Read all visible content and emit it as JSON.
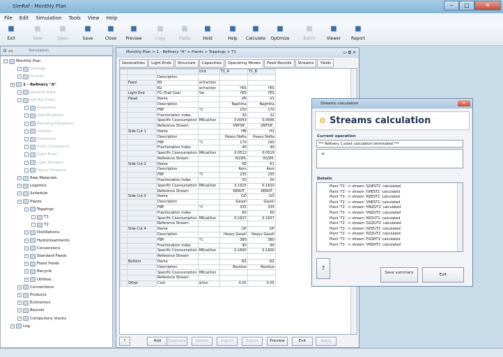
{
  "app": {
    "title": "SimRaf - Monthly Plan"
  },
  "menu": [
    "File",
    "Edit",
    "Simulation",
    "Tools",
    "View",
    "Help"
  ],
  "toolbar": [
    {
      "label": "Exit",
      "icon": "exit-icon",
      "enabled": true
    },
    {
      "label": "New",
      "icon": "new-icon",
      "enabled": false
    },
    {
      "label": "Open",
      "icon": "open-icon",
      "enabled": false
    },
    {
      "label": "Save",
      "icon": "save-icon",
      "enabled": true
    },
    {
      "label": "Close",
      "icon": "close-folder-icon",
      "enabled": true
    },
    {
      "label": "Preview",
      "icon": "preview-icon",
      "enabled": true
    },
    {
      "label": "Copy",
      "icon": "copy-icon",
      "enabled": false
    },
    {
      "label": "Paste",
      "icon": "paste-icon",
      "enabled": false
    },
    {
      "label": "Hold",
      "icon": "hold-icon",
      "enabled": true
    },
    {
      "label": "Help",
      "icon": "help-icon",
      "enabled": true
    },
    {
      "label": "Calculate",
      "icon": "calculate-icon",
      "enabled": true
    },
    {
      "label": "Optimize",
      "icon": "optimize-icon",
      "enabled": true
    },
    {
      "label": "Batch",
      "icon": "batch-icon",
      "enabled": false
    },
    {
      "label": "Viewer",
      "icon": "viewer-icon",
      "enabled": true
    },
    {
      "label": "Report",
      "icon": "report-icon",
      "enabled": true
    }
  ],
  "left_panel": {
    "tab_label": "Simulation"
  },
  "tree": [
    {
      "label": "Monthly Plan",
      "indent": 0,
      "dim": false,
      "bold": false
    },
    {
      "label": "Settings",
      "indent": 2,
      "dim": true,
      "bold": false
    },
    {
      "label": "Periods",
      "indent": 2,
      "dim": true,
      "bold": false
    },
    {
      "label": "1 - Refinery \"A\"",
      "indent": 1,
      "dim": false,
      "bold": true
    },
    {
      "label": "General Data",
      "indent": 2,
      "dim": true,
      "bold": false
    },
    {
      "label": "Sell Est Data",
      "indent": 2,
      "dim": true,
      "bold": false
    },
    {
      "label": "Properties",
      "indent": 3,
      "dim": true,
      "bold": false
    },
    {
      "label": "Specifications",
      "indent": 3,
      "dim": true,
      "bold": false
    },
    {
      "label": "Blending Equations",
      "indent": 3,
      "dim": true,
      "bold": false
    },
    {
      "label": "Utilities",
      "indent": 3,
      "dim": true,
      "bold": false
    },
    {
      "label": "Emissions",
      "indent": 3,
      "dim": true,
      "bold": false
    },
    {
      "label": "Price Constraints",
      "indent": 3,
      "dim": true,
      "bold": false
    },
    {
      "label": "Light Ends",
      "indent": 3,
      "dim": true,
      "bold": false
    },
    {
      "label": "Light Streams",
      "indent": 3,
      "dim": true,
      "bold": false
    },
    {
      "label": "Heavy Streams",
      "indent": 3,
      "dim": true,
      "bold": false
    },
    {
      "label": "Raw Materials",
      "indent": 2,
      "dim": false,
      "bold": false
    },
    {
      "label": "Logistics",
      "indent": 2,
      "dim": false,
      "bold": false
    },
    {
      "label": "Schedule",
      "indent": 2,
      "dim": false,
      "bold": false
    },
    {
      "label": "Plants",
      "indent": 2,
      "dim": false,
      "bold": false
    },
    {
      "label": "Toppings",
      "indent": 3,
      "dim": false,
      "bold": false
    },
    {
      "label": "T1",
      "indent": 4,
      "dim": false,
      "bold": false
    },
    {
      "label": "T2",
      "indent": 4,
      "dim": false,
      "bold": false
    },
    {
      "label": "Distillations",
      "indent": 3,
      "dim": false,
      "bold": false
    },
    {
      "label": "Hydrotreatments",
      "indent": 3,
      "dim": false,
      "bold": false
    },
    {
      "label": "Conversions",
      "indent": 3,
      "dim": false,
      "bold": false
    },
    {
      "label": "Standard Feeds",
      "indent": 3,
      "dim": false,
      "bold": false
    },
    {
      "label": "Fixed Yields",
      "indent": 3,
      "dim": false,
      "bold": false
    },
    {
      "label": "Recycle",
      "indent": 3,
      "dim": false,
      "bold": false
    },
    {
      "label": "Utilities",
      "indent": 3,
      "dim": false,
      "bold": false
    },
    {
      "label": "Connections",
      "indent": 2,
      "dim": false,
      "bold": false
    },
    {
      "label": "Products",
      "indent": 2,
      "dim": false,
      "bold": false
    },
    {
      "label": "Economics",
      "indent": 2,
      "dim": false,
      "bold": false
    },
    {
      "label": "Bounds",
      "indent": 2,
      "dim": false,
      "bold": false
    },
    {
      "label": "Compulsory stocks",
      "indent": 2,
      "dim": false,
      "bold": false
    },
    {
      "label": "Log",
      "indent": 1,
      "dim": false,
      "bold": false
    }
  ],
  "doc_window": {
    "title": "Monthly Plan > 1 - Refinery \"A\" > Plants > Toppings > T1",
    "tabs": [
      "Generalities",
      "Light Ends",
      "Structure",
      "Capacities",
      "Operating Modes",
      "Feed Bounds",
      "Streams",
      "Yields"
    ],
    "active_tab": "Operating Modes",
    "columns": [
      "",
      "",
      "",
      "Unit",
      "T1_A",
      "T1_B"
    ],
    "rows": [
      [
        "",
        "",
        "Description",
        "",
        "",
        ""
      ],
      [
        "",
        "Feed",
        "BS",
        "w.fraction",
        "",
        ""
      ],
      [
        "",
        "",
        "B2",
        "w.fraction",
        "YES",
        "YES"
      ],
      [
        "",
        "Light End",
        "FG (Fuel Gas)",
        "Sw",
        "YES",
        "YES"
      ],
      [
        "",
        "Head",
        "Name",
        "",
        "VN",
        "V1"
      ],
      [
        "",
        "",
        "Description",
        "",
        "Naphtha",
        "Naphtha"
      ],
      [
        "",
        "",
        "FBP",
        "°C",
        "150",
        "170"
      ],
      [
        "",
        "",
        "Fractionation Index",
        "",
        "30",
        "32"
      ],
      [
        "",
        "",
        "Specific Cosnsumption",
        "MKcal/ton",
        "0.0043",
        "0.0046"
      ],
      [
        "",
        "",
        "Reference Stream",
        "",
        "VNTOP_",
        "VNTOP_"
      ],
      [
        "",
        "Side Cut 1",
        "Name",
        "",
        "HN",
        "H1"
      ],
      [
        "",
        "",
        "Description",
        "",
        "Heavy Nafta",
        "Heavy Nafta"
      ],
      [
        "",
        "",
        "FBP",
        "°C",
        "170",
        "190"
      ],
      [
        "",
        "",
        "Fractionation Index",
        "",
        "40",
        "40"
      ],
      [
        "",
        "",
        "Specific Cosnsumption",
        "MKcal/ton",
        "0.0512",
        "0.0519"
      ],
      [
        "",
        "",
        "Reference Stream",
        "",
        "N1SPL",
        "N1SPL"
      ],
      [
        "",
        "Side Cut 2",
        "Name",
        "",
        "KE",
        "K1"
      ],
      [
        "",
        "",
        "Description",
        "",
        "Kero",
        "Kero"
      ],
      [
        "",
        "",
        "FBP",
        "°C",
        "235",
        "235"
      ],
      [
        "",
        "",
        "Fractionation Index",
        "",
        "50",
        "50"
      ],
      [
        "",
        "",
        "Specific Cosnsumption",
        "MKcal/ton",
        "0.1625",
        "0.1620"
      ],
      [
        "",
        "",
        "Reference Stream",
        "",
        "KEROT_",
        "KEROT_"
      ],
      [
        "",
        "Side Cut 3",
        "Name",
        "",
        "GO",
        "GO"
      ],
      [
        "",
        "",
        "Description",
        "",
        "Gasoil",
        "Gasoil"
      ],
      [
        "",
        "",
        "FBP",
        "°C",
        "335",
        "335"
      ],
      [
        "",
        "",
        "Fractionation Index",
        "",
        "60",
        "60"
      ],
      [
        "",
        "",
        "Specific Cosnsumption",
        "MKcal/ton",
        "0.1637",
        "0.1637"
      ],
      [
        "",
        "",
        "Reference Stream",
        "",
        "",
        ""
      ],
      [
        "",
        "Side Cut 4",
        "Name",
        "",
        "GP",
        "GP"
      ],
      [
        "",
        "",
        "Description",
        "",
        "Heavy Gasoil",
        "Heavy Gasoil"
      ],
      [
        "",
        "",
        "FBP",
        "°C",
        "380",
        "380"
      ],
      [
        "",
        "",
        "Fractionation Index",
        "",
        "90",
        "90"
      ],
      [
        "",
        "",
        "Specific Cosnsumption",
        "MKcal/ton",
        "0.1600",
        "0.1600"
      ],
      [
        "",
        "",
        "Reference Stream",
        "",
        "",
        ""
      ],
      [
        "",
        "Bottom",
        "Name",
        "",
        "RZ",
        "RZ"
      ],
      [
        "",
        "",
        "Description",
        "",
        "Residue",
        "Residue"
      ],
      [
        "",
        "",
        "Specific Cosnsumption",
        "MKcal/ton",
        "",
        ""
      ],
      [
        "",
        "",
        "Reference Stream",
        "",
        "",
        ""
      ],
      [
        "",
        "Other",
        "Cost",
        "$/ton",
        "0.05",
        "0.05"
      ]
    ],
    "buttons": [
      {
        "label": "Add",
        "enabled": true
      },
      {
        "label": "Duplicate",
        "enabled": false
      },
      {
        "label": "Delete",
        "enabled": false
      },
      {
        "label": "Import",
        "enabled": false
      },
      {
        "label": "Export",
        "enabled": false
      },
      {
        "label": "Preview",
        "enabled": true
      },
      {
        "label": "Exit",
        "enabled": true
      },
      {
        "label": "Apply",
        "enabled": false
      }
    ]
  },
  "calc_dialog": {
    "window_title": "Streams calculation",
    "header": "Streams calculation",
    "current_operation_label": "Current operation",
    "current_operation": "*** Refinery 1 plant calculation terminated ***",
    "details_label": "Details",
    "details": [
      "Plant 'T1' -> stream 'GOEST1' calculated",
      "Plant 'T1' -> stream 'GPEST1' calculated",
      "Plant 'T1' -> stream 'RZEST1' calculated",
      "Plant 'T1' -> stream 'VNEST1' calculated",
      "Plant 'T1' -> stream 'HNZUT1' calculated",
      "Plant 'T1' -> stream 'VNZUT1' calculated",
      "Plant 'T1' -> stream 'KEZUT1' calculated",
      "Plant 'T1' -> stream 'GOZUT1' calculated",
      "Plant 'T1' -> stream 'GPZUT1' calculated",
      "Plant 'T1' -> stream 'RZZUT1' calculated",
      "Plant 'T1' -> stream 'FGSHT1' calculated",
      "Plant 'T1' -> stream 'VNSHT1' calculated"
    ],
    "save_button": "Save summary",
    "exit_button": "Exit"
  }
}
